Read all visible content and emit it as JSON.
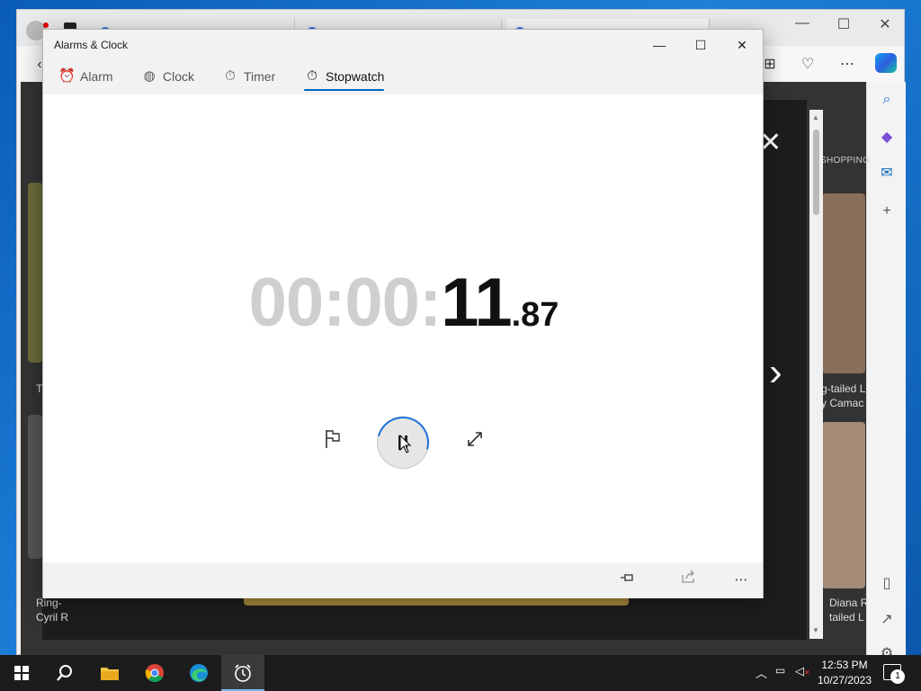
{
  "app": {
    "title": "Alarms & Clock",
    "nav": [
      {
        "label": "Alarm",
        "icon": "alarm-icon"
      },
      {
        "label": "Clock",
        "icon": "globe-clock-icon"
      },
      {
        "label": "Timer",
        "icon": "timer-icon"
      },
      {
        "label": "Stopwatch",
        "icon": "stopwatch-icon",
        "active": true
      }
    ],
    "stopwatch": {
      "hours": "00:",
      "minutes": "00:",
      "seconds": "11",
      "hundredths": ".87",
      "state": "running"
    }
  },
  "browser_background": {
    "shopping_label": "SHOPPING",
    "captions": {
      "left_top": "T",
      "left_bottom_1": "Ring-",
      "left_bottom_2": "Cyril R",
      "right_top_1": "g-tailed L",
      "right_top_2": "y Camac",
      "right_bottom_1": "Diana R",
      "right_bottom_2": "tailed L"
    }
  },
  "taskbar": {
    "time": "12:53 PM",
    "date": "10/27/2023",
    "notification_count": "1"
  },
  "colors": {
    "accent": "#0067c0",
    "digits_dim": "#cfcfcf",
    "digits_active": "#111111",
    "taskbar": "#1c1c1c"
  }
}
